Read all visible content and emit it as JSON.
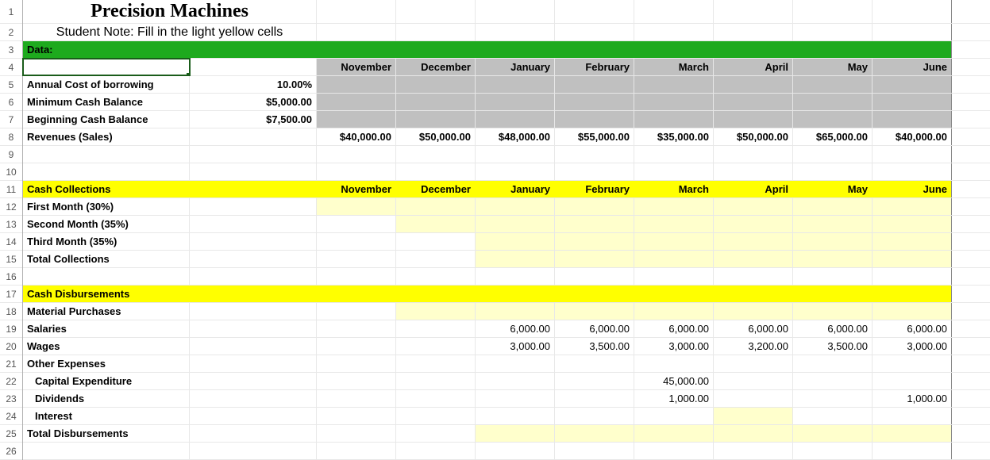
{
  "title": "Precision Machines",
  "subtitle": "Student Note: Fill in the light yellow cells",
  "section_data": "Data:",
  "months": [
    "November",
    "December",
    "January",
    "February",
    "March",
    "April",
    "May",
    "June"
  ],
  "inputs": {
    "annual_cost_label": "Annual Cost of borrowing",
    "annual_cost_value": "10.00%",
    "min_cash_label": "Minimum Cash Balance",
    "min_cash_value": "$5,000.00",
    "beg_cash_label": "Beginning Cash Balance",
    "beg_cash_value": "$7,500.00"
  },
  "revenues": {
    "label": "Revenues (Sales)",
    "values": [
      "$40,000.00",
      "$50,000.00",
      "$48,000.00",
      "$55,000.00",
      "$35,000.00",
      "$50,000.00",
      "$65,000.00",
      "$40,000.00"
    ]
  },
  "cash_collections": {
    "header": "Cash Collections",
    "first_month": "First Month  (30%)",
    "second_month": "Second Month  (35%)",
    "third_month": "Third Month  (35%)",
    "total": "Total Collections"
  },
  "cash_disbursements": {
    "header": "Cash Disbursements",
    "material_purchases": "Material Purchases",
    "salaries": {
      "label": "Salaries",
      "values": [
        "",
        "",
        "6,000.00",
        "6,000.00",
        "6,000.00",
        "6,000.00",
        "6,000.00",
        "6,000.00"
      ]
    },
    "wages": {
      "label": "Wages",
      "values": [
        "",
        "",
        "3,000.00",
        "3,500.00",
        "3,000.00",
        "3,200.00",
        "3,500.00",
        "3,000.00"
      ]
    },
    "other_expenses": "Other Expenses",
    "capex": {
      "label": "Capital Expenditure",
      "values": [
        "",
        "",
        "",
        "",
        "45,000.00",
        "",
        "",
        ""
      ]
    },
    "dividends": {
      "label": "Dividends",
      "values": [
        "",
        "",
        "",
        "",
        "1,000.00",
        "",
        "",
        "1,000.00"
      ]
    },
    "interest": "Interest",
    "total": "Total Disbursements"
  },
  "chart_data": {
    "type": "table",
    "title": "Precision Machines Cash Budget",
    "columns": [
      "November",
      "December",
      "January",
      "February",
      "March",
      "April",
      "May",
      "June"
    ],
    "rows": [
      {
        "label": "Revenues (Sales)",
        "values": [
          40000,
          50000,
          48000,
          55000,
          35000,
          50000,
          65000,
          40000
        ]
      },
      {
        "label": "Salaries",
        "values": [
          null,
          null,
          6000,
          6000,
          6000,
          6000,
          6000,
          6000
        ]
      },
      {
        "label": "Wages",
        "values": [
          null,
          null,
          3000,
          3500,
          3000,
          3200,
          3500,
          3000
        ]
      },
      {
        "label": "Capital Expenditure",
        "values": [
          null,
          null,
          null,
          null,
          45000,
          null,
          null,
          null
        ]
      },
      {
        "label": "Dividends",
        "values": [
          null,
          null,
          null,
          null,
          1000,
          null,
          null,
          1000
        ]
      }
    ],
    "parameters": {
      "annual_cost_of_borrowing_pct": 10.0,
      "minimum_cash_balance": 5000,
      "beginning_cash_balance": 7500
    }
  }
}
